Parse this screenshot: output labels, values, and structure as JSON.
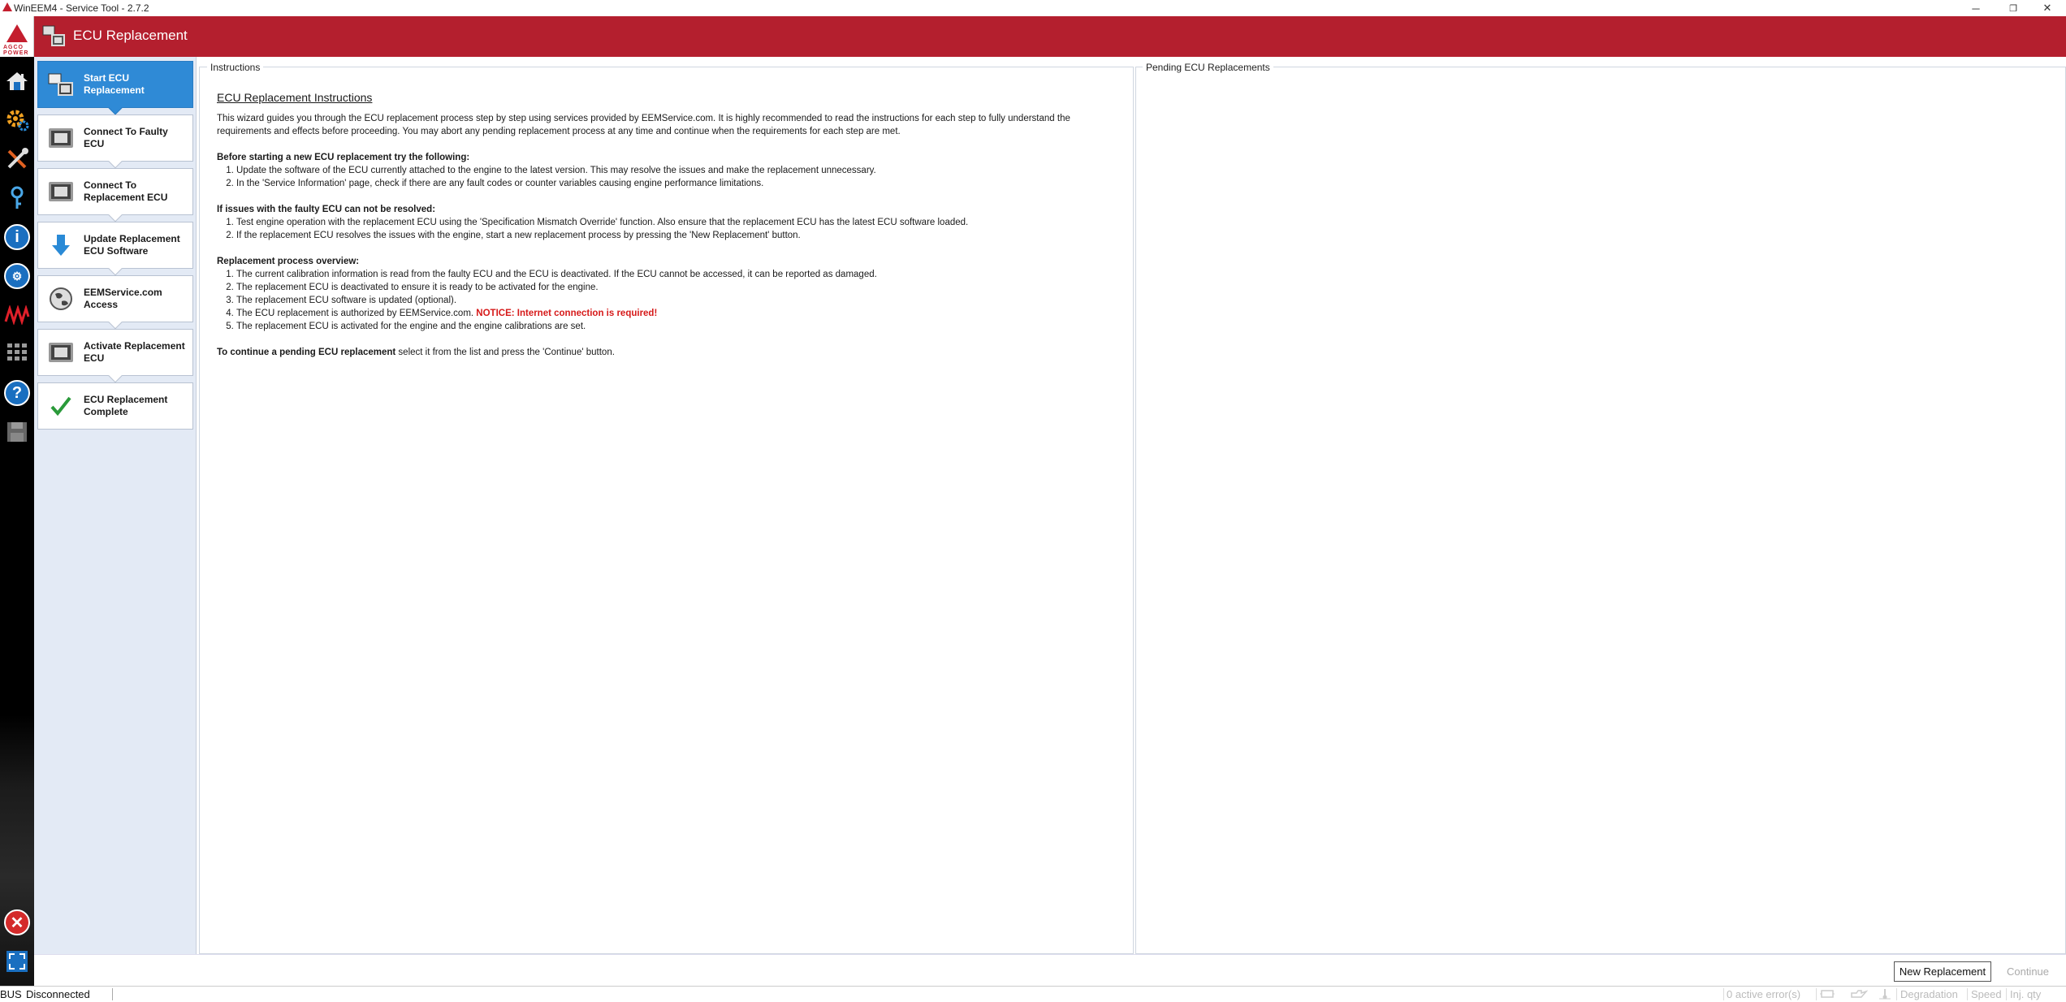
{
  "window": {
    "title": "WinEEM4 - Service Tool - 2.7.2",
    "controls": {
      "minimize": "─",
      "maximize": "❐",
      "close": "✕"
    }
  },
  "brand": {
    "logo_text": "AGCO POWER"
  },
  "colors": {
    "header": "#b41f2e",
    "active_step": "#2f8ad6",
    "notice": "#d61a1a"
  },
  "sidebar_icons": [
    "home-icon",
    "gear-icon",
    "tools-icon",
    "key-icon",
    "info-icon",
    "service-info-icon",
    "waveform-icon",
    "keypad-icon",
    "help-icon",
    "floppy-disk-icon",
    "exit-icon",
    "fullscreen-icon"
  ],
  "header": {
    "title": "ECU Replacement"
  },
  "steps": [
    {
      "label": "Start ECU Replacement",
      "active": true
    },
    {
      "label": "Connect To Faulty ECU",
      "active": false
    },
    {
      "label": "Connect To Replacement ECU",
      "active": false
    },
    {
      "label": "Update Replacement ECU Software",
      "active": false
    },
    {
      "label": "EEMService.com Access",
      "active": false
    },
    {
      "label": "Activate Replacement ECU",
      "active": false
    },
    {
      "label": "ECU Replacement Complete",
      "active": false
    }
  ],
  "instructions": {
    "group_label": "Instructions",
    "heading": "ECU Replacement Instructions",
    "intro": "This wizard guides you through the ECU replacement process step by step using services provided by EEMService.com. It is highly recommended to read the instructions for each step to fully understand the requirements and effects before proceeding. You may abort any pending replacement process at any time and continue when the requirements for each step are met.",
    "before_title": "Before starting a new ECU replacement try the following:",
    "before_items": [
      "Update the software of the ECU currently attached to the engine to the latest version. This may resolve the issues and make the replacement unnecessary.",
      "In the 'Service Information' page, check if there are any fault codes or counter variables causing engine performance limitations."
    ],
    "issues_title": "If issues with the faulty ECU can not be resolved:",
    "issues_items": [
      "Test engine operation with the replacement ECU using the 'Specification Mismatch Override' function. Also ensure that the replacement ECU has the latest ECU software loaded.",
      "If the replacement ECU resolves the issues with the engine, start a new replacement process by pressing the 'New Replacement' button."
    ],
    "overview_title": "Replacement process overview:",
    "overview_items": [
      "The current calibration information is read from the faulty ECU and the ECU is deactivated. If the ECU cannot be accessed, it can be reported as damaged.",
      "The replacement ECU is deactivated to ensure it is ready to be activated for the engine.",
      "The replacement ECU software is updated (optional).",
      "The ECU replacement is authorized by EEMService.com.",
      "The replacement ECU is activated for the engine and the engine calibrations are set."
    ],
    "overview_notice": "NOTICE: Internet connection is required!",
    "continue_bold": "To continue a pending ECU replacement",
    "continue_rest": " select it from the list and press the 'Continue' button."
  },
  "pending": {
    "group_label": "Pending ECU Replacements"
  },
  "buttons": {
    "new_replacement": "New Replacement",
    "continue": "Continue"
  },
  "status": {
    "bus_label": "BUS",
    "connection": "Disconnected",
    "errors": "0 active error(s)",
    "degradation": "Degradation",
    "speed": "Speed",
    "inj_qty": "Inj. qty"
  }
}
